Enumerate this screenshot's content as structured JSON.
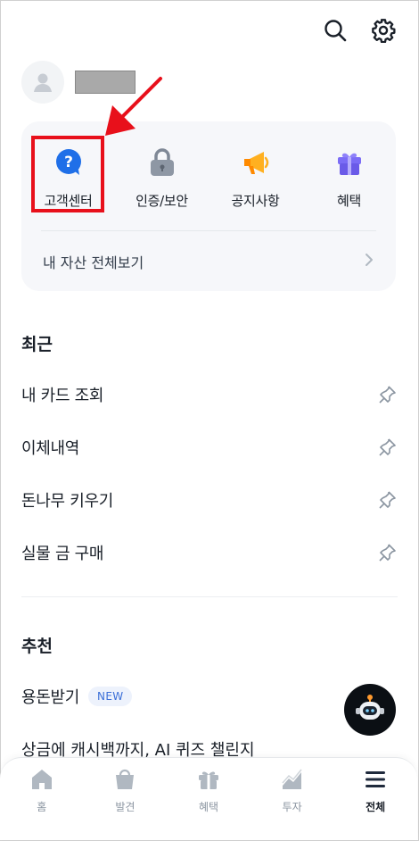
{
  "profile": {
    "name_redacted": ""
  },
  "quick_menu": [
    {
      "label": "고객센터",
      "icon": "question-bubble-icon"
    },
    {
      "label": "인증/보안",
      "icon": "lock-icon"
    },
    {
      "label": "공지사항",
      "icon": "megaphone-icon"
    },
    {
      "label": "혜택",
      "icon": "gift-icon"
    }
  ],
  "asset_link": "내 자산 전체보기",
  "recent": {
    "title": "최근",
    "items": [
      "내 카드 조회",
      "이체내역",
      "돈나무 키우기",
      "실물 금 구매"
    ]
  },
  "recommend": {
    "title": "추천",
    "items": [
      {
        "label": "용돈받기",
        "badge": "NEW"
      },
      {
        "label": "상금에 캐시백까지, AI 퀴즈 챌린지"
      }
    ]
  },
  "tabs": [
    {
      "label": "홈",
      "icon": "home-icon"
    },
    {
      "label": "발견",
      "icon": "shopping-bag-icon"
    },
    {
      "label": "혜택",
      "icon": "gift-icon"
    },
    {
      "label": "투자",
      "icon": "chart-icon"
    },
    {
      "label": "전체",
      "icon": "menu-icon",
      "active": true
    }
  ],
  "colors": {
    "accent": "#0064ff",
    "highlight": "#e8101b"
  }
}
